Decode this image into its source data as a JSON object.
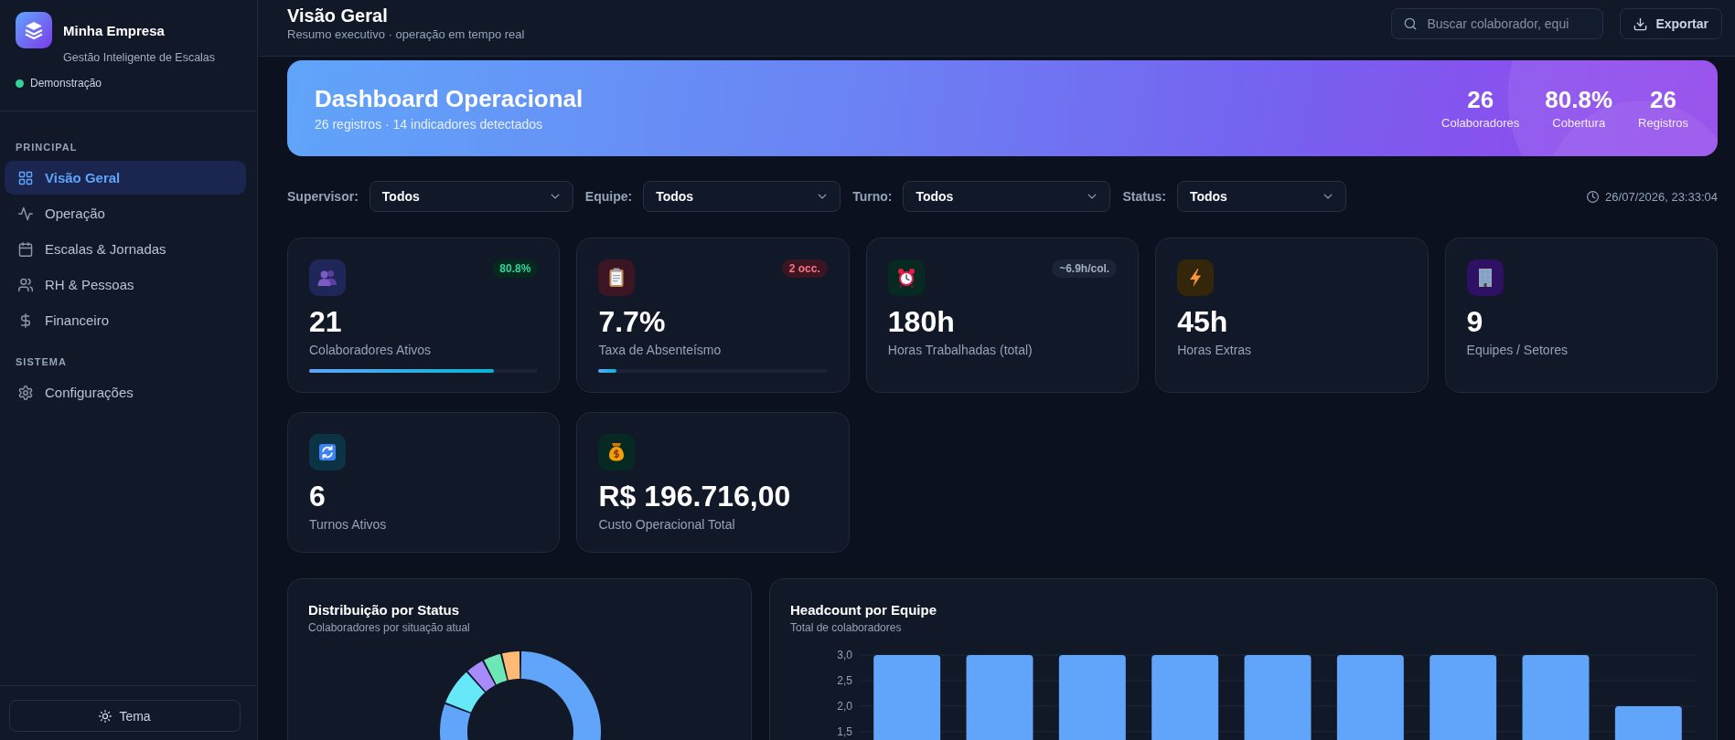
{
  "sidebar": {
    "brand": {
      "name": "Minha Empresa",
      "tagline": "Gestão Inteligente de Escalas"
    },
    "status": "Demonstração",
    "sections": [
      {
        "title": "PRINCIPAL",
        "items": [
          {
            "label": "Visão Geral",
            "selected": true
          },
          {
            "label": "Operação",
            "selected": false
          },
          {
            "label": "Escalas & Jornadas",
            "selected": false
          },
          {
            "label": "RH & Pessoas",
            "selected": false
          },
          {
            "label": "Financeiro",
            "selected": false
          }
        ]
      },
      {
        "title": "SISTEMA",
        "items": [
          {
            "label": "Configurações",
            "selected": false
          }
        ]
      }
    ],
    "theme_button": "Tema"
  },
  "header": {
    "title": "Visão Geral",
    "subtitle": "Resumo executivo · operação em tempo real",
    "search": {
      "placeholder": "Buscar colaborador, equi"
    },
    "export_button": "Exportar"
  },
  "banner": {
    "title": "Dashboard Operacional",
    "subtitle": "26 registros · 14 indicadores detectados",
    "stats": [
      {
        "value": "26",
        "label": "Colaboradores"
      },
      {
        "value": "80.8%",
        "label": "Cobertura"
      },
      {
        "value": "26",
        "label": "Registros"
      }
    ]
  },
  "filter_bar": {
    "filters": [
      {
        "label": "Supervisor:",
        "value": "Todos"
      },
      {
        "label": "Equipe:",
        "value": "Todos"
      },
      {
        "label": "Turno:",
        "value": "Todos"
      },
      {
        "label": "Status:",
        "value": "Todos"
      }
    ],
    "timestamp": "26/07/2026, 23:33:04"
  },
  "kpi_cards": [
    {
      "value": "21",
      "label": "Colaboradores Ativos",
      "badge": {
        "text": "80.8%",
        "kind": "positive"
      },
      "level": 0.808
    },
    {
      "value": "7.7%",
      "label": "Taxa de Absenteísmo",
      "badge": {
        "text": "2 occ.",
        "kind": "negative"
      },
      "level": 0.077
    },
    {
      "value": "180h",
      "label": "Horas Trabalhadas (total)",
      "badge": {
        "text": "~6.9h/col.",
        "kind": "neutral"
      }
    },
    {
      "value": "45h",
      "label": "Horas Extras"
    },
    {
      "value": "9",
      "label": "Equipes / Setores"
    },
    {
      "value": "6",
      "label": "Turnos Ativos"
    },
    {
      "value": "R$ 196.716,00",
      "label": "Custo Operacional Total"
    }
  ],
  "charts": [
    {
      "kind": "donut",
      "title": "Distribuição por Status",
      "subtitle": "Colaboradores por situação atual"
    },
    {
      "kind": "bar",
      "title": "Headcount por Equipe",
      "subtitle": "Total de colaboradores",
      "chart_data": {
        "type": "bar",
        "values": [
          3,
          3,
          3,
          3,
          3,
          3,
          3,
          3,
          2
        ],
        "ylim": [
          1.3,
          3
        ],
        "grid": true,
        "yticks": [
          {
            "value": 3,
            "label": "3,0"
          },
          {
            "value": 2.5,
            "label": "2,5"
          },
          {
            "value": 2,
            "label": "2,0"
          },
          {
            "value": 1.5,
            "label": "1,5"
          }
        ]
      }
    }
  ]
}
